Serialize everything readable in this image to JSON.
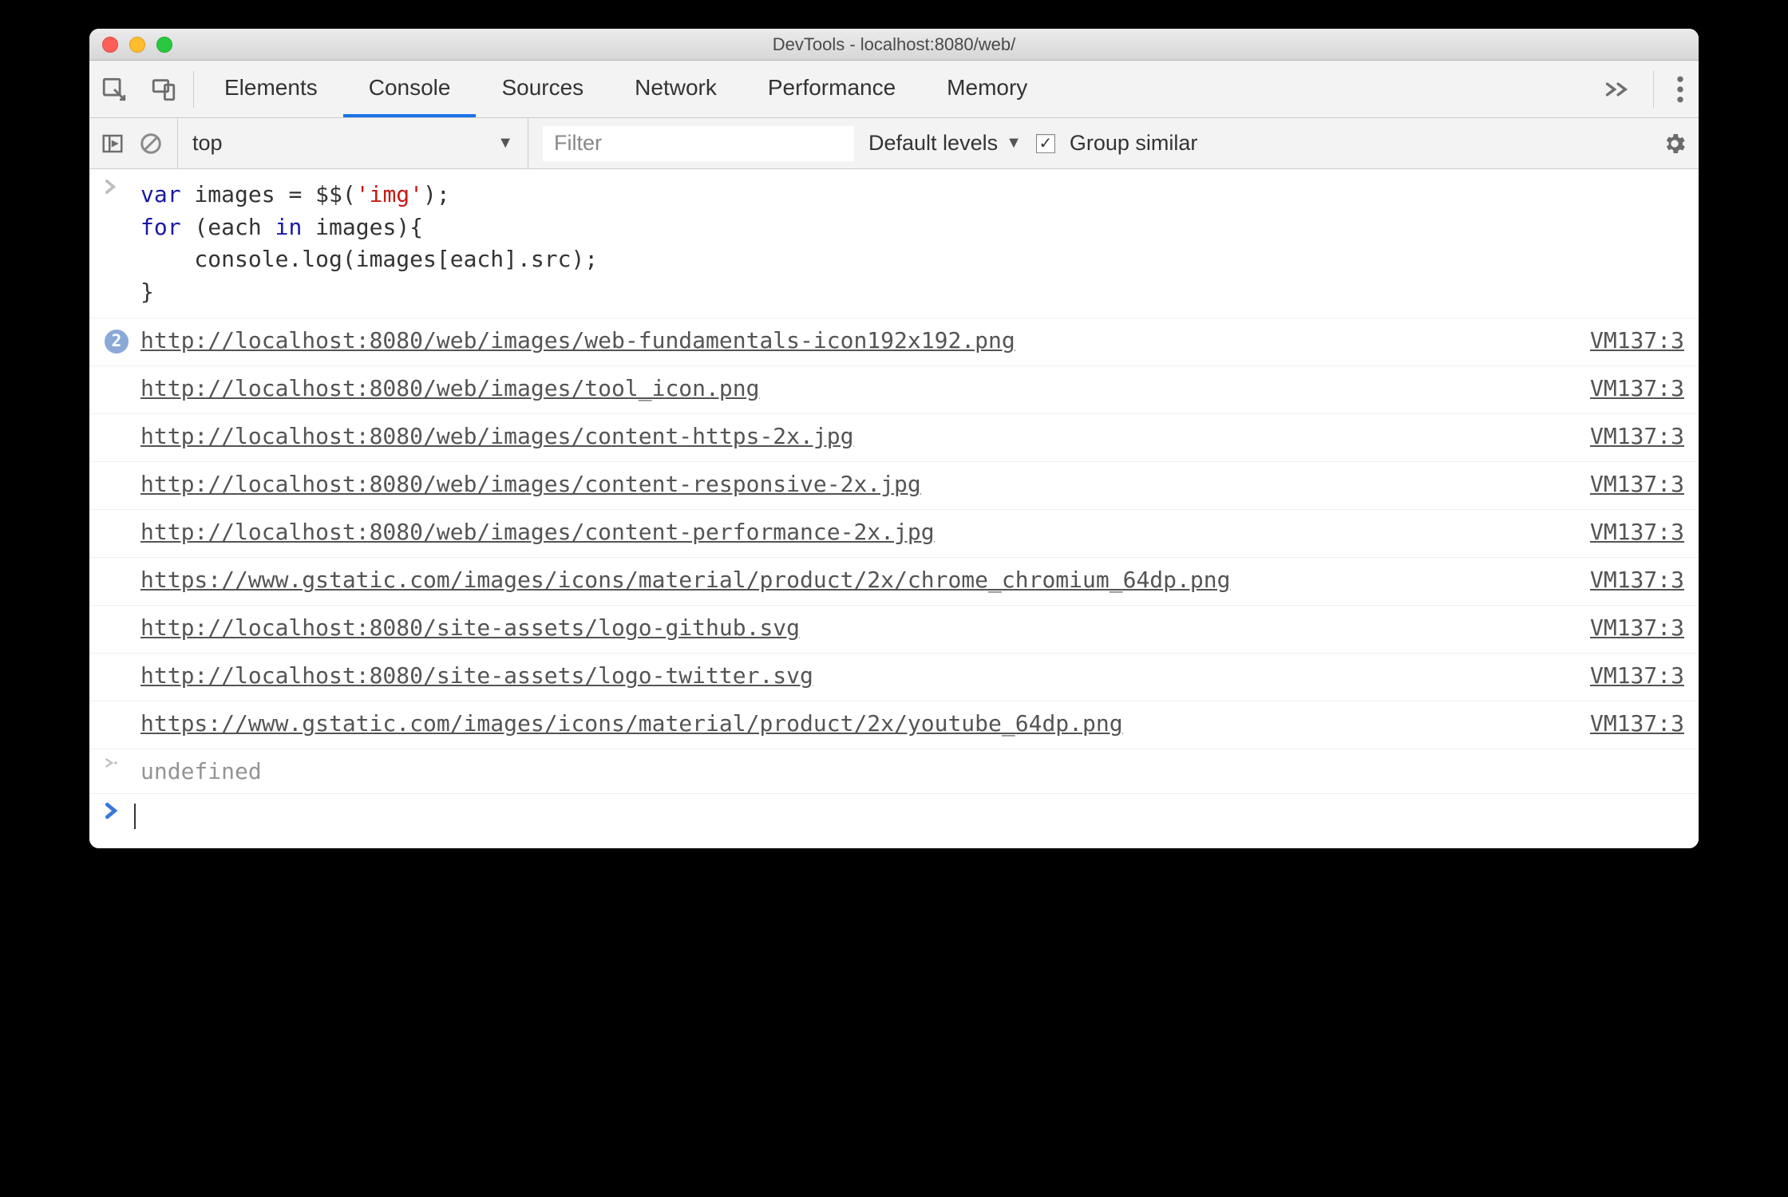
{
  "window": {
    "title": "DevTools - localhost:8080/web/"
  },
  "tabs": {
    "items": [
      "Elements",
      "Console",
      "Sources",
      "Network",
      "Performance",
      "Memory"
    ],
    "active": "Console"
  },
  "toolbar2": {
    "context": "top",
    "filter_placeholder": "Filter",
    "levels_label": "Default levels",
    "group_similar_label": "Group similar",
    "group_similar_checked": true
  },
  "code": {
    "line1_kw1": "var",
    "line1_ident": " images = $$(",
    "line1_str": "'img'",
    "line1_end": ");",
    "line2_kw1": "for",
    "line2_a": " (each ",
    "line2_kw2": "in",
    "line2_b": " images){",
    "line3": "    console.log(images[each].src);",
    "line4": "}"
  },
  "logs": [
    {
      "badge": "2",
      "url": "http://localhost:8080/web/images/web-fundamentals-icon192x192.png",
      "src": "VM137:3"
    },
    {
      "url": "http://localhost:8080/web/images/tool_icon.png",
      "src": "VM137:3"
    },
    {
      "url": "http://localhost:8080/web/images/content-https-2x.jpg",
      "src": "VM137:3"
    },
    {
      "url": "http://localhost:8080/web/images/content-responsive-2x.jpg",
      "src": "VM137:3"
    },
    {
      "url": "http://localhost:8080/web/images/content-performance-2x.jpg",
      "src": "VM137:3"
    },
    {
      "url": "https://www.gstatic.com/images/icons/material/product/2x/chrome_chromium_64dp.png",
      "src": "VM137:3"
    },
    {
      "url": "http://localhost:8080/site-assets/logo-github.svg",
      "src": "VM137:3"
    },
    {
      "url": "http://localhost:8080/site-assets/logo-twitter.svg",
      "src": "VM137:3"
    },
    {
      "url": "https://www.gstatic.com/images/icons/material/product/2x/youtube_64dp.png",
      "src": "VM137:3"
    }
  ],
  "result": {
    "text": "undefined"
  }
}
